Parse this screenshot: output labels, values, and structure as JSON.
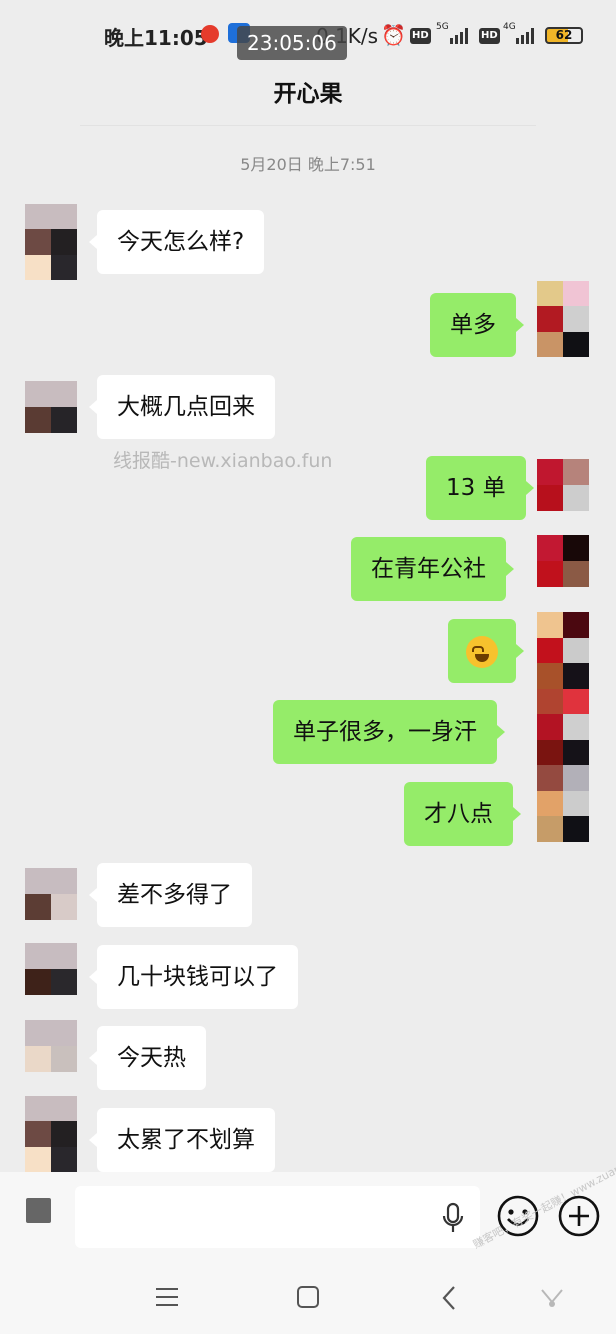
{
  "status_bar": {
    "time": "晚上11:05",
    "overlay_clock": "23:05:06",
    "net_speed": "0.1K/s",
    "alarm_icon": "alarm-clock-icon",
    "hd1": "HD",
    "net1": "5G",
    "hd2": "HD",
    "net2": "4G",
    "battery": "62"
  },
  "header": {
    "title": "开心果"
  },
  "chat": {
    "timestamp": "5月20日 晚上7:51",
    "watermark": "线报酷-new.xianbao.fun",
    "messages": [
      {
        "dir": "in",
        "text": "今天怎么样?"
      },
      {
        "dir": "out",
        "text": "单多"
      },
      {
        "dir": "in",
        "text": "大概几点回来"
      },
      {
        "dir": "out",
        "text": "13 单"
      },
      {
        "dir": "out",
        "text": "在青年公社"
      },
      {
        "dir": "out",
        "emoji": "laughing-crying-face-emoji"
      },
      {
        "dir": "out",
        "text": "单子很多，一身汗"
      },
      {
        "dir": "out",
        "text": "才八点"
      },
      {
        "dir": "in",
        "text": "差不多得了"
      },
      {
        "dir": "in",
        "text": "几十块钱可以了"
      },
      {
        "dir": "in",
        "text": "今天热"
      },
      {
        "dir": "in",
        "text": "太累了不划算"
      }
    ]
  },
  "input_bar": {
    "text_value": "",
    "voice_icon": "voice-toggle-icon",
    "mic_icon": "microphone-icon",
    "emoji_icon": "smiley-icon",
    "plus_icon": "plus-circle-icon"
  },
  "nav_bar": {
    "menu_icon": "menu-icon",
    "home_icon": "home-icon",
    "back_icon": "back-icon"
  },
  "corner_watermark": "赚客吧，有奖一起赚！www.zuanke8.com",
  "colors": {
    "background": "#ededed",
    "incoming_bubble": "#ffffff",
    "outgoing_bubble": "#95ec69",
    "timestamp_text": "#888888"
  }
}
